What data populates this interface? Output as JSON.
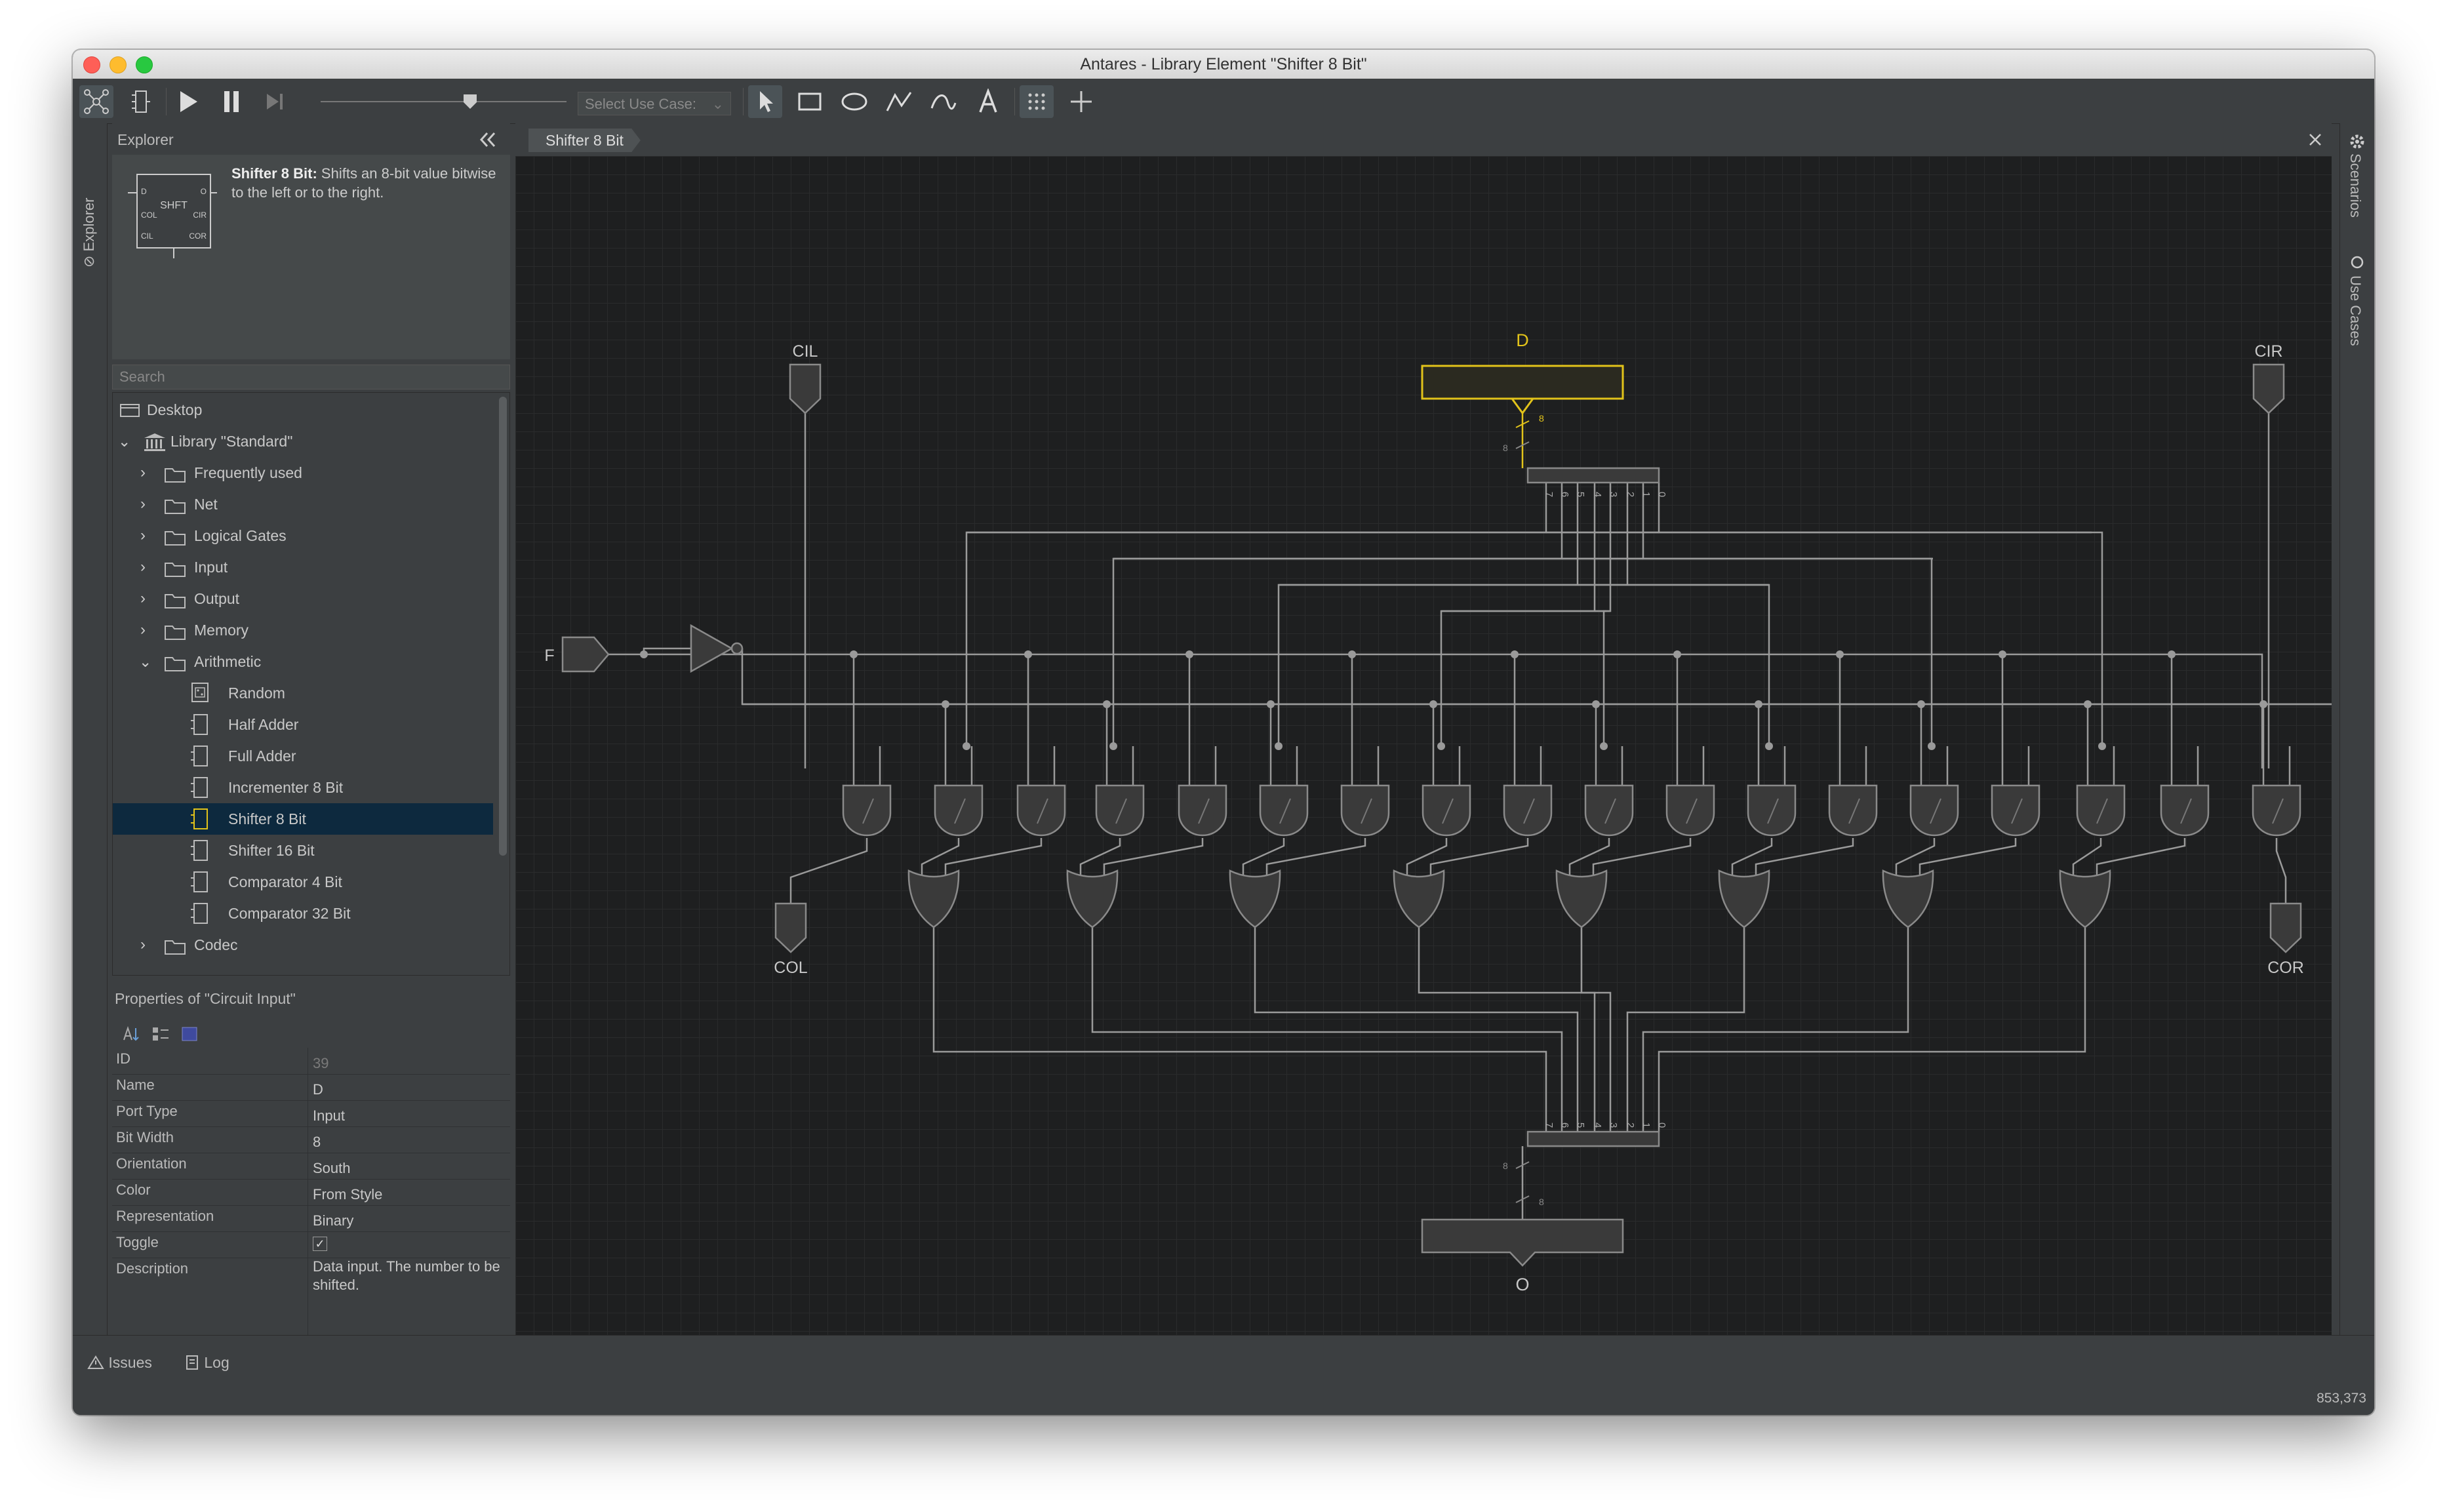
{
  "window": {
    "title": "Antares - Library Element \"Shifter 8 Bit\""
  },
  "toolbar": {
    "select_use_case_placeholder": "Select Use Case:"
  },
  "side_tabs": {
    "explorer": "Explorer",
    "scenarios": "Scenarios",
    "use_cases": "Use Cases"
  },
  "explorer": {
    "title": "Explorer",
    "preview": {
      "element_name": "Shifter 8 Bit:",
      "description": "Shifts an 8-bit value bitwise to the left or to the right.",
      "symbol_title": "SHFT",
      "pin_labels": [
        "D",
        "COL",
        "CIL",
        "O",
        "CIR",
        "COR"
      ]
    },
    "search_placeholder": "Search",
    "tree": [
      {
        "label": "Desktop",
        "level": 0
      },
      {
        "label": "Library \"Standard\"",
        "level": 0
      },
      {
        "label": "Frequently used",
        "level": 1
      },
      {
        "label": "Net",
        "level": 1
      },
      {
        "label": "Logical Gates",
        "level": 1
      },
      {
        "label": "Input",
        "level": 1
      },
      {
        "label": "Output",
        "level": 1
      },
      {
        "label": "Memory",
        "level": 1
      },
      {
        "label": "Arithmetic",
        "level": 1
      },
      {
        "label": "Random",
        "level": 2
      },
      {
        "label": "Half Adder",
        "level": 2
      },
      {
        "label": "Full Adder",
        "level": 2
      },
      {
        "label": "Incrementer 8 Bit",
        "level": 2
      },
      {
        "label": "Shifter 8 Bit",
        "level": 2,
        "selected": true
      },
      {
        "label": "Shifter 16 Bit",
        "level": 2
      },
      {
        "label": "Comparator 4 Bit",
        "level": 2
      },
      {
        "label": "Comparator 32 Bit",
        "level": 2
      },
      {
        "label": "Codec",
        "level": 1
      }
    ]
  },
  "properties": {
    "title": "Properties of \"Circuit Input\"",
    "rows": [
      {
        "key": "ID",
        "value": "39"
      },
      {
        "key": "Name",
        "value": "D"
      },
      {
        "key": "Port Type",
        "value": "Input"
      },
      {
        "key": "Bit Width",
        "value": "8"
      },
      {
        "key": "Orientation",
        "value": "South"
      },
      {
        "key": "Color",
        "value": "From Style"
      },
      {
        "key": "Representation",
        "value": "Binary"
      },
      {
        "key": "Toggle",
        "value": "✓"
      },
      {
        "key": "Description",
        "value": "Data input. The number to be shifted."
      }
    ]
  },
  "editor": {
    "tab_label": "Shifter 8 Bit"
  },
  "circuit": {
    "label_cil": "CIL",
    "label_d": "D",
    "label_cir": "CIR",
    "label_f": "F",
    "label_col": "COL",
    "label_cor": "COR",
    "label_o": "O",
    "bus_width": "8",
    "bit_indices": [
      "7",
      "6",
      "5",
      "4",
      "3",
      "2",
      "1",
      "0"
    ]
  },
  "status": {
    "issues": "Issues",
    "log": "Log",
    "coords": "853,373"
  }
}
